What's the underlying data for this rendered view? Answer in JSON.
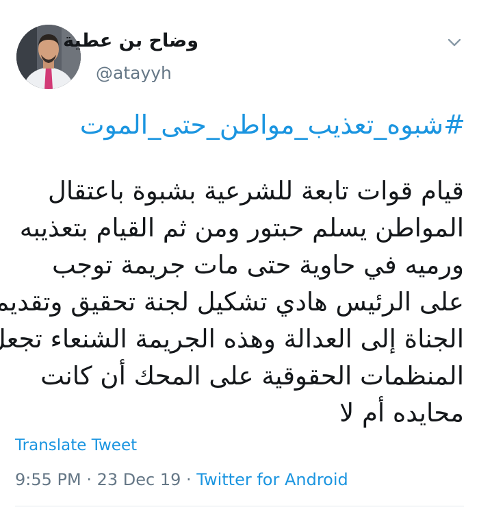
{
  "user": {
    "display_name": "وضاح بن عطية",
    "handle": "@atayyh"
  },
  "icons": {
    "menu": "chevron-down-icon",
    "avatar": "profile-photo"
  },
  "tweet": {
    "hashtag": "#شبوه_تعذيب_مواطن_حتى_الموت",
    "lines": [
      "قيام قوات تابعة للشرعية بشبوة باعتقال",
      "المواطن يسلم حبتور ومن ثم القيام بتعذيبه",
      "ورميه في حاوية حتى مات جريمة توجب",
      "على الرئيس هادي تشكيل لجنة تحقيق وتقديم",
      "الجناة إلى العدالة وهذه الجريمة الشنعاء تجعل",
      "المنظمات الحقوقية على المحك أن كانت",
      "محايده أم لا"
    ],
    "translate_label": "Translate Tweet"
  },
  "meta": {
    "time": "9:55 PM",
    "separator": " · ",
    "date": "23 Dec 19",
    "source": "Twitter for Android"
  },
  "colors": {
    "link": "#1b95e0",
    "secondary": "#657786",
    "text": "#14171a"
  }
}
